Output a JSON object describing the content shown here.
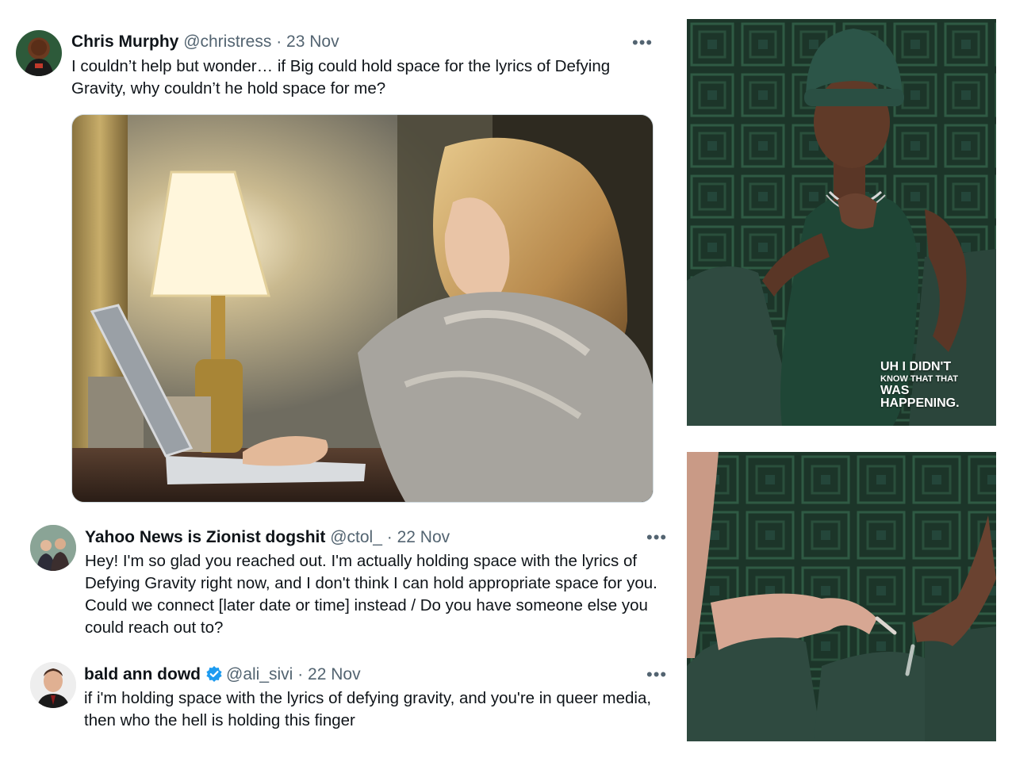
{
  "tweets": [
    {
      "name": "Chris Murphy",
      "handle": "@christress",
      "date": "23 Nov",
      "text": "I couldn’t help but wonder… if Big could hold space for the lyrics of Defying Gravity, why couldn’t he hold space for me?"
    },
    {
      "name": "Yahoo News is Zionist dogshit",
      "handle": "@ctol_",
      "date": "22 Nov",
      "text": "Hey! I'm so glad you reached out. I'm actually holding space with the lyrics of Defying Gravity right now, and I don't think I can hold appropriate space for you. Could we connect [later date or time] instead / Do you have someone else you could reach out to?"
    },
    {
      "name": "bald ann dowd",
      "handle": "@ali_sivi",
      "date": "22 Nov",
      "text": "if i'm holding space with the lyrics of defying gravity, and you're in queer media, then who the hell is holding this finger",
      "verified": true
    }
  ],
  "separator": "·",
  "more_glyph": "•••",
  "right_panel": {
    "top_caption_line1": "UH I DIDN'T",
    "top_caption_line2": "KNOW THAT THAT",
    "top_caption_line3": "WAS",
    "top_caption_line4": "HAPPENING."
  },
  "colors": {
    "verified_blue": "#1d9bf0",
    "muted_text": "#536471",
    "green_wall": "#1e3a2c",
    "sofa": "#2f4a40"
  }
}
